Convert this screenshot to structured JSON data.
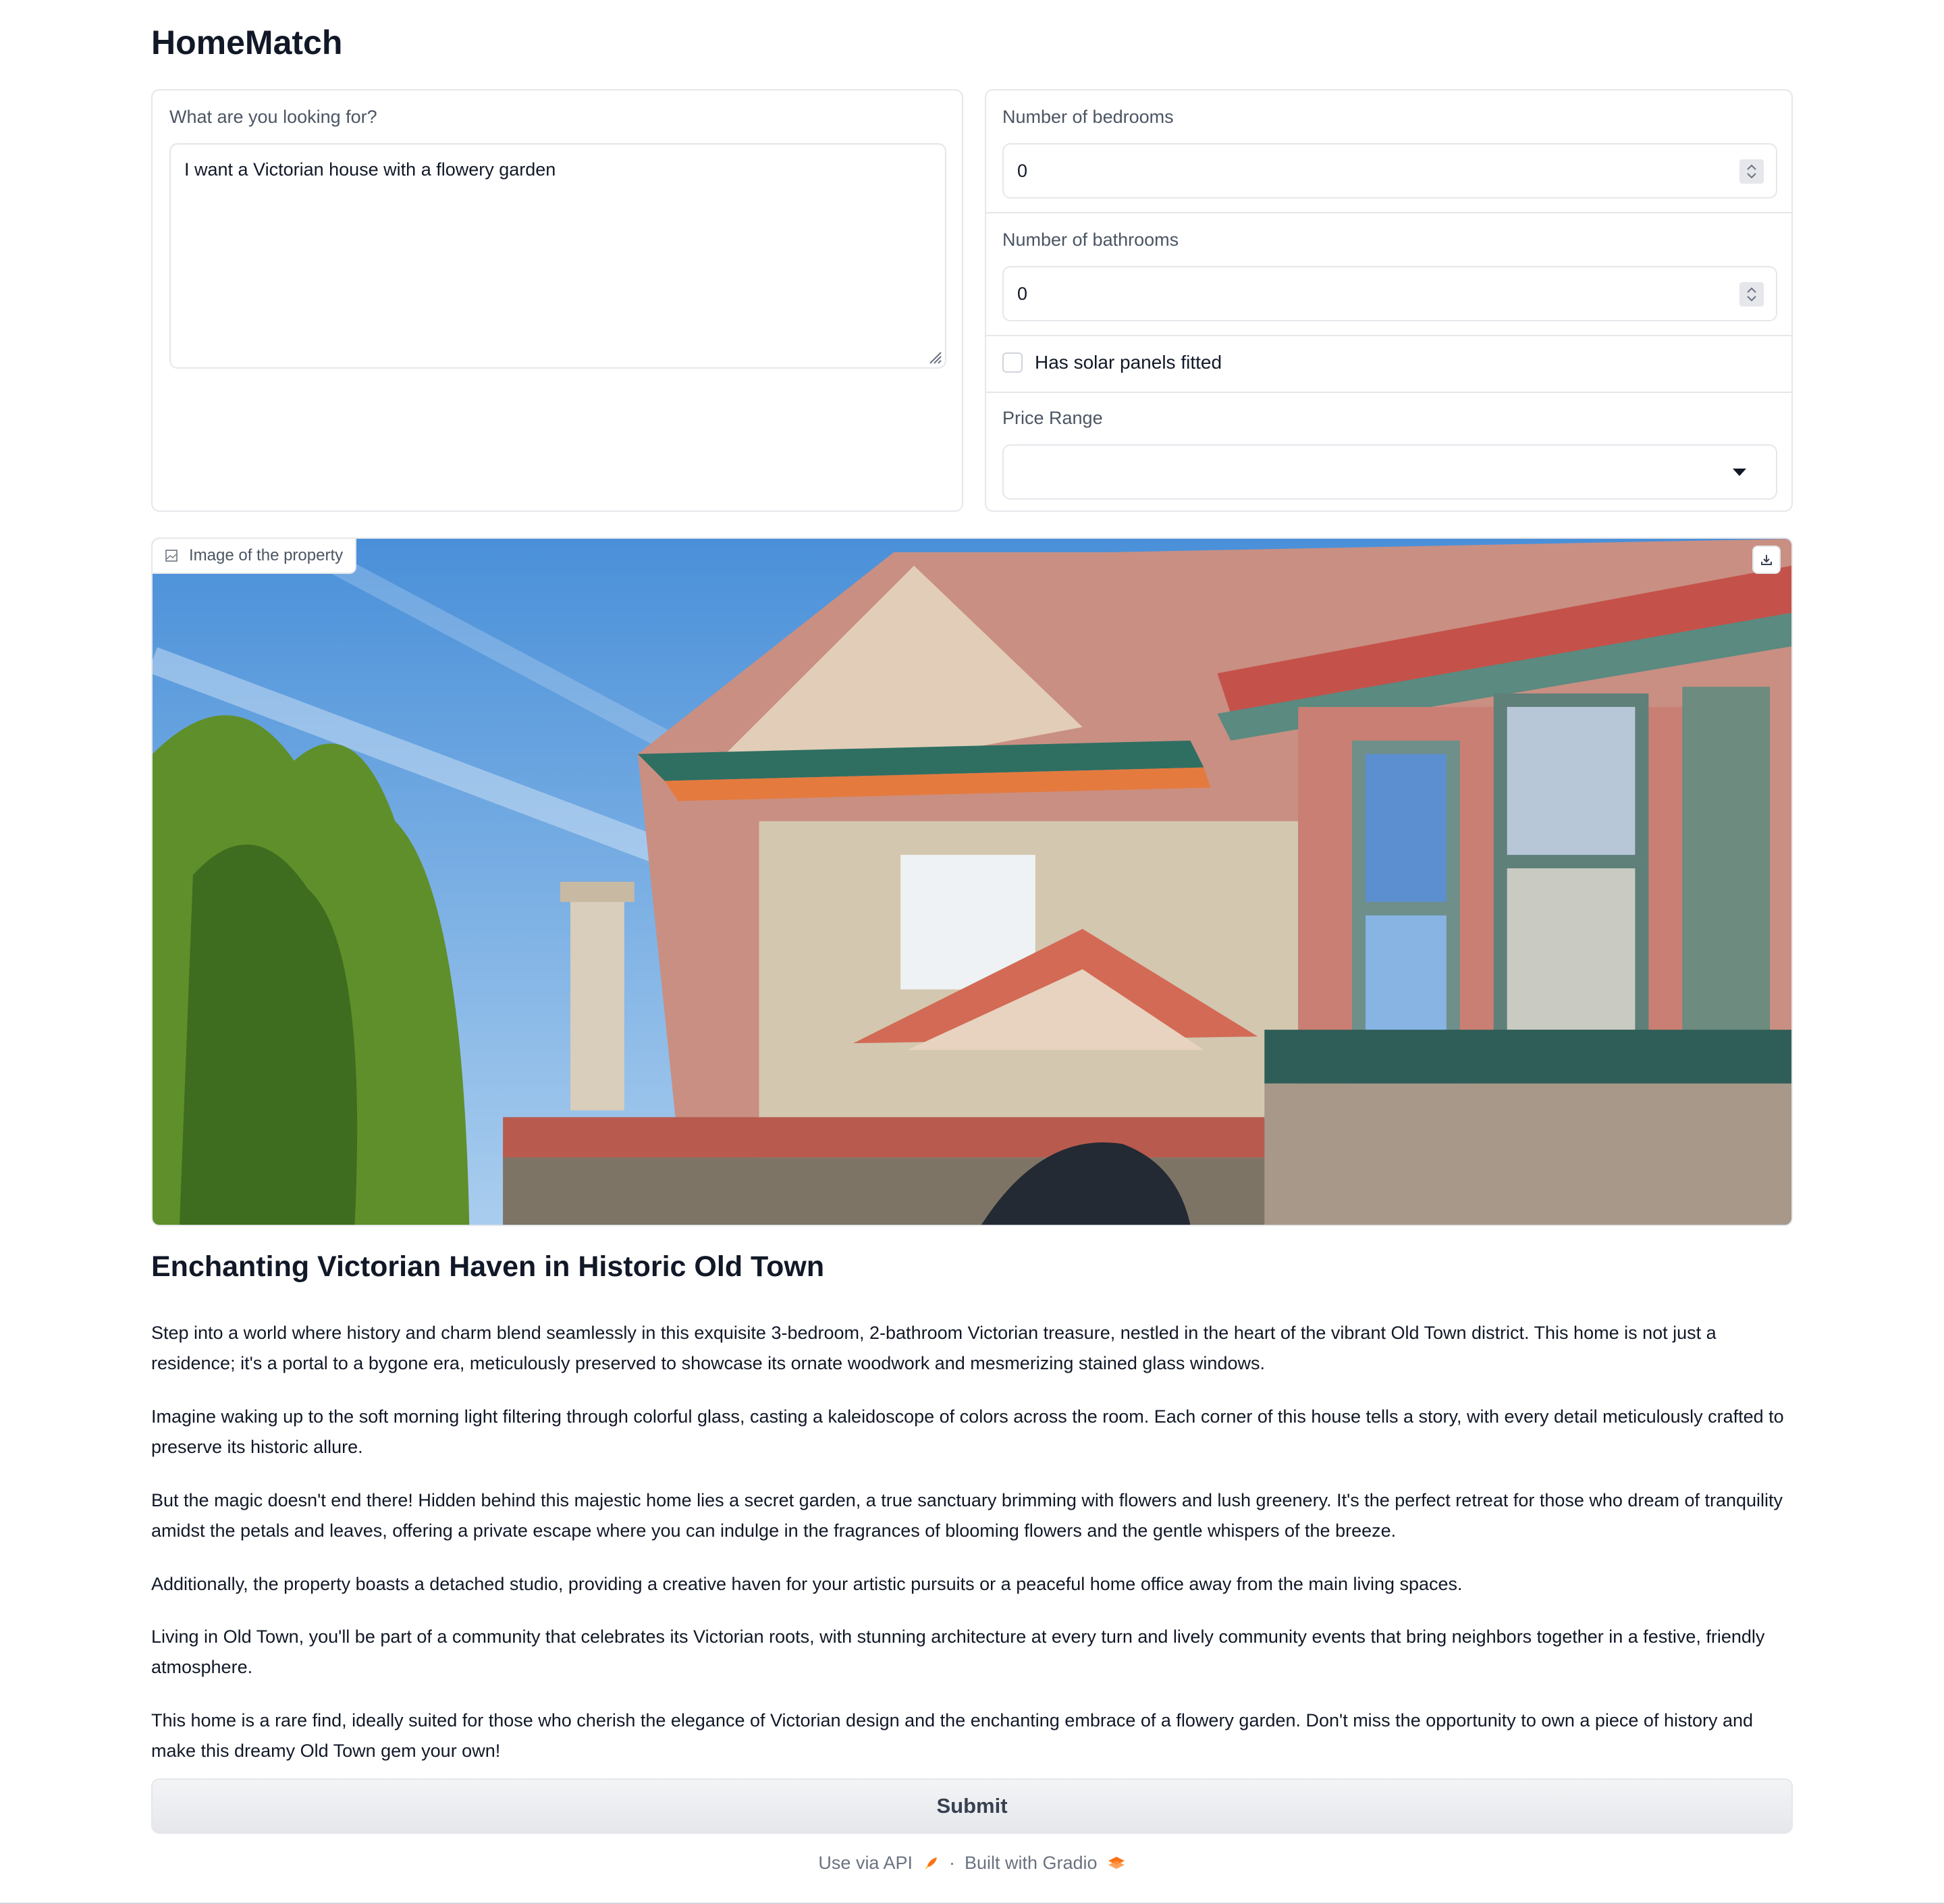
{
  "app": {
    "title": "HomeMatch"
  },
  "query": {
    "label": "What are you looking for?",
    "value": "I want a Victorian house with a flowery garden"
  },
  "filters": {
    "bedrooms": {
      "label": "Number of bedrooms",
      "value": "0"
    },
    "bathrooms": {
      "label": "Number of bathrooms",
      "value": "0"
    },
    "solar": {
      "label": "Has solar panels fitted",
      "checked": false
    },
    "price": {
      "label": "Price Range",
      "value": ""
    }
  },
  "image": {
    "label": "Image of the property",
    "icon": "image-icon",
    "download_icon": "download-icon"
  },
  "listing": {
    "title": "Enchanting Victorian Haven in Historic Old Town",
    "paragraphs": [
      "Step into a world where history and charm blend seamlessly in this exquisite 3-bedroom, 2-bathroom Victorian treasure, nestled in the heart of the vibrant Old Town district. This home is not just a residence; it's a portal to a bygone era, meticulously preserved to showcase its ornate woodwork and mesmerizing stained glass windows.",
      "Imagine waking up to the soft morning light filtering through colorful glass, casting a kaleidoscope of colors across the room. Each corner of this house tells a story, with every detail meticulously crafted to preserve its historic allure.",
      "But the magic doesn't end there! Hidden behind this majestic home lies a secret garden, a true sanctuary brimming with flowers and lush greenery. It's the perfect retreat for those who dream of tranquility amidst the petals and leaves, offering a private escape where you can indulge in the fragrances of blooming flowers and the gentle whispers of the breeze.",
      "Additionally, the property boasts a detached studio, providing a creative haven for your artistic pursuits or a peaceful home office away from the main living spaces.",
      "Living in Old Town, you'll be part of a community that celebrates its Victorian roots, with stunning architecture at every turn and lively community events that bring neighbors together in a festive, friendly atmosphere.",
      "This home is a rare find, ideally suited for those who cherish the elegance of Victorian design and the enchanting embrace of a flowery garden. Don't miss the opportunity to own a piece of history and make this dreamy Old Town gem your own!"
    ]
  },
  "actions": {
    "submit_label": "Submit"
  },
  "footer": {
    "api_label": "Use via API",
    "separator": "·",
    "built_label": "Built with Gradio"
  }
}
